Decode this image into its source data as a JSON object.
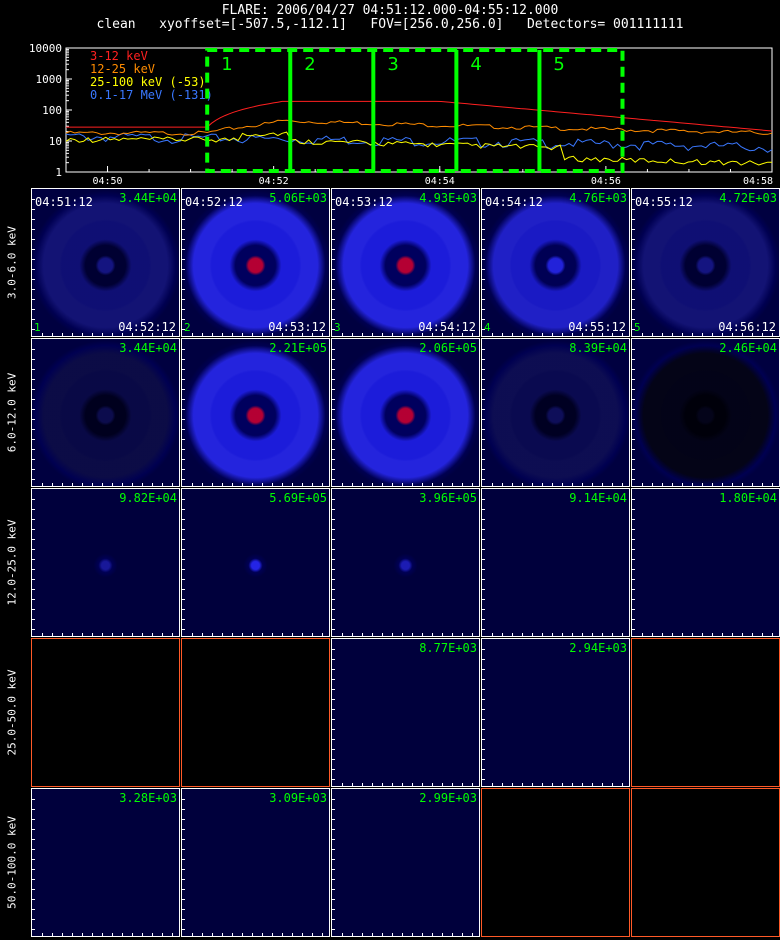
{
  "header": {
    "line1": "FLARE: 2006/04/27 04:51:12.000-04:55:12.000",
    "line2": "clean   xyoffset=[-507.5,-112.1]   FOV=[256.0,256.0]   Detectors= 001111111"
  },
  "lightcurve": {
    "yticks": [
      "10000",
      "1000",
      "100",
      "10",
      "1"
    ],
    "xticks": [
      "04:50",
      "04:52",
      "04:54",
      "04:56",
      "04:58"
    ],
    "legend": [
      {
        "label": "3-12 keV",
        "color": "#ff2020"
      },
      {
        "label": "12-25 keV",
        "color": "#ff8c00"
      },
      {
        "label": "25-100 keV (-53)",
        "color": "#ffff00"
      },
      {
        "label": "0.1-17 MeV (-131)",
        "color": "#3a78ff"
      }
    ],
    "intervals": [
      "1",
      "2",
      "3",
      "4",
      "5"
    ],
    "interval_color": "#00ff00"
  },
  "rows": [
    {
      "label": "3.0-6.0 keV",
      "panels": [
        {
          "value": "3.44E+04",
          "time": "04:51:12",
          "end": "04:52:12",
          "index": "1",
          "kind": "ring"
        },
        {
          "value": "5.06E+03",
          "time": "04:52:12",
          "end": "04:53:12",
          "index": "2",
          "kind": "ring"
        },
        {
          "value": "4.93E+03",
          "time": "04:53:12",
          "end": "04:54:12",
          "index": "3",
          "kind": "ring"
        },
        {
          "value": "4.76E+03",
          "time": "04:54:12",
          "end": "04:55:12",
          "index": "4",
          "kind": "ring"
        },
        {
          "value": "4.72E+03",
          "time": "04:55:12",
          "end": "04:56:12",
          "index": "5",
          "kind": "ring"
        }
      ]
    },
    {
      "label": "6.0-12.0 keV",
      "panels": [
        {
          "value": "3.44E+04",
          "kind": "ring"
        },
        {
          "value": "2.21E+05",
          "kind": "ring"
        },
        {
          "value": "2.06E+05",
          "kind": "ring"
        },
        {
          "value": "8.39E+04",
          "kind": "ring"
        },
        {
          "value": "2.46E+04",
          "kind": "ring"
        }
      ]
    },
    {
      "label": "12.0-25.0 keV",
      "panels": [
        {
          "value": "9.82E+04",
          "kind": "dark"
        },
        {
          "value": "5.69E+05",
          "kind": "dark"
        },
        {
          "value": "3.96E+05",
          "kind": "dark"
        },
        {
          "value": "9.14E+04",
          "kind": "dark"
        },
        {
          "value": "1.80E+04",
          "kind": "dark"
        }
      ]
    },
    {
      "label": "25.0-50.0 keV",
      "panels": [
        {
          "value": "",
          "kind": "black"
        },
        {
          "value": "",
          "kind": "black"
        },
        {
          "value": "8.77E+03",
          "kind": "dark"
        },
        {
          "value": "2.94E+03",
          "kind": "dark"
        },
        {
          "value": "",
          "kind": "black"
        }
      ]
    },
    {
      "label": "50.0-100.0 keV",
      "panels": [
        {
          "value": "3.28E+03",
          "kind": "dark"
        },
        {
          "value": "3.09E+03",
          "kind": "dark"
        },
        {
          "value": "2.99E+03",
          "kind": "dark"
        },
        {
          "value": "",
          "kind": "black"
        },
        {
          "value": "",
          "kind": "black"
        }
      ]
    }
  ]
}
